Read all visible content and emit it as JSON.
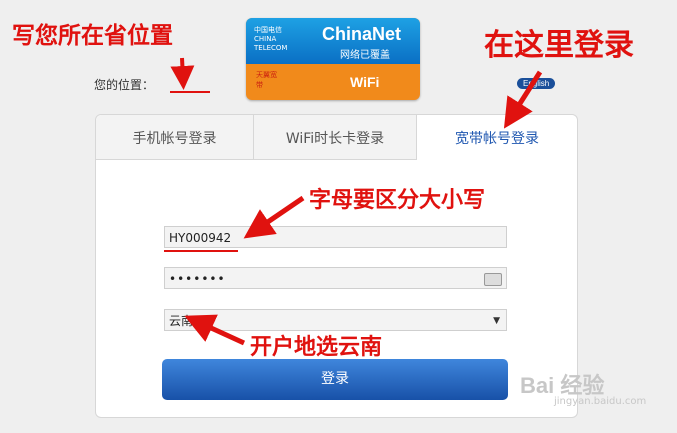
{
  "annotations": {
    "location_hint": "写您所在省位置",
    "login_here": "在这里登录",
    "case_sensitive": "字母要区分大小写",
    "choose_region": "开户地选云南"
  },
  "location": {
    "label": "您的位置："
  },
  "card": {
    "logo_text": "中国电信 CHINA TELECOM",
    "brand": "ChinaNet",
    "subtitle": "网络已覆盖",
    "wifi": "WiFi",
    "bottom_logo_text": "天翼宽带"
  },
  "english_label": "English",
  "tabs": [
    {
      "label": "手机帐号登录"
    },
    {
      "label": "WiFi时长卡登录"
    },
    {
      "label": "宽带帐号登录"
    }
  ],
  "form": {
    "account_value": "HY000942",
    "password_value": "•••••••",
    "region_value": "云南",
    "login_label": "登录"
  },
  "watermark": {
    "brand": "Bai 经验",
    "url": "jingyan.baidu.com"
  },
  "colors": {
    "annotation": "#e0120f",
    "active_tab": "#1f57b0",
    "button": "#1851a8"
  }
}
